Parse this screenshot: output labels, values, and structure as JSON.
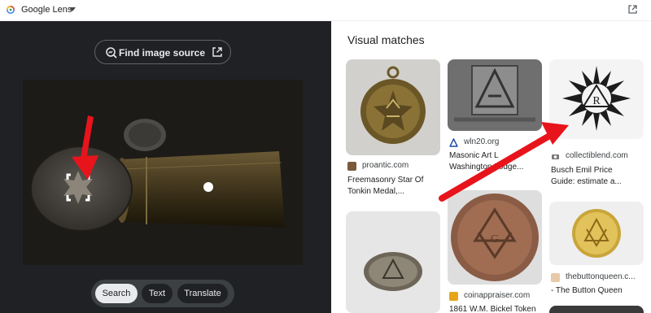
{
  "topbar": {
    "app_title": "Google Lens"
  },
  "left_panel": {
    "find_source_label": "Find image source",
    "modes": [
      "Search",
      "Text",
      "Translate"
    ],
    "active_mode": "Search"
  },
  "right_panel": {
    "heading": "Visual matches",
    "results": [
      {
        "source": "proantic.com",
        "title_line1": "Freemasonry Star Of",
        "title_line2": "Tonkin Medal,..."
      },
      {
        "source": "wln20.org",
        "title_line1": "Masonic Art L",
        "title_line2": "Washington Lodge..."
      },
      {
        "source": "collectiblend.com",
        "title_line1": "Busch Emil Price",
        "title_line2": "Guide: estimate a..."
      },
      {
        "source": "",
        "title_line1": "",
        "title_line2": ""
      },
      {
        "source": "coinappraiser.com",
        "title_line1": "1861 W.M. Bickel Token",
        "title_line2": ""
      },
      {
        "source": "thebuttonqueen.c...",
        "title_line1": "- The Button Queen",
        "title_line2": ""
      }
    ]
  },
  "colors": {
    "annotation_arrow": "#e8141c",
    "dark_panel": "#202124"
  }
}
